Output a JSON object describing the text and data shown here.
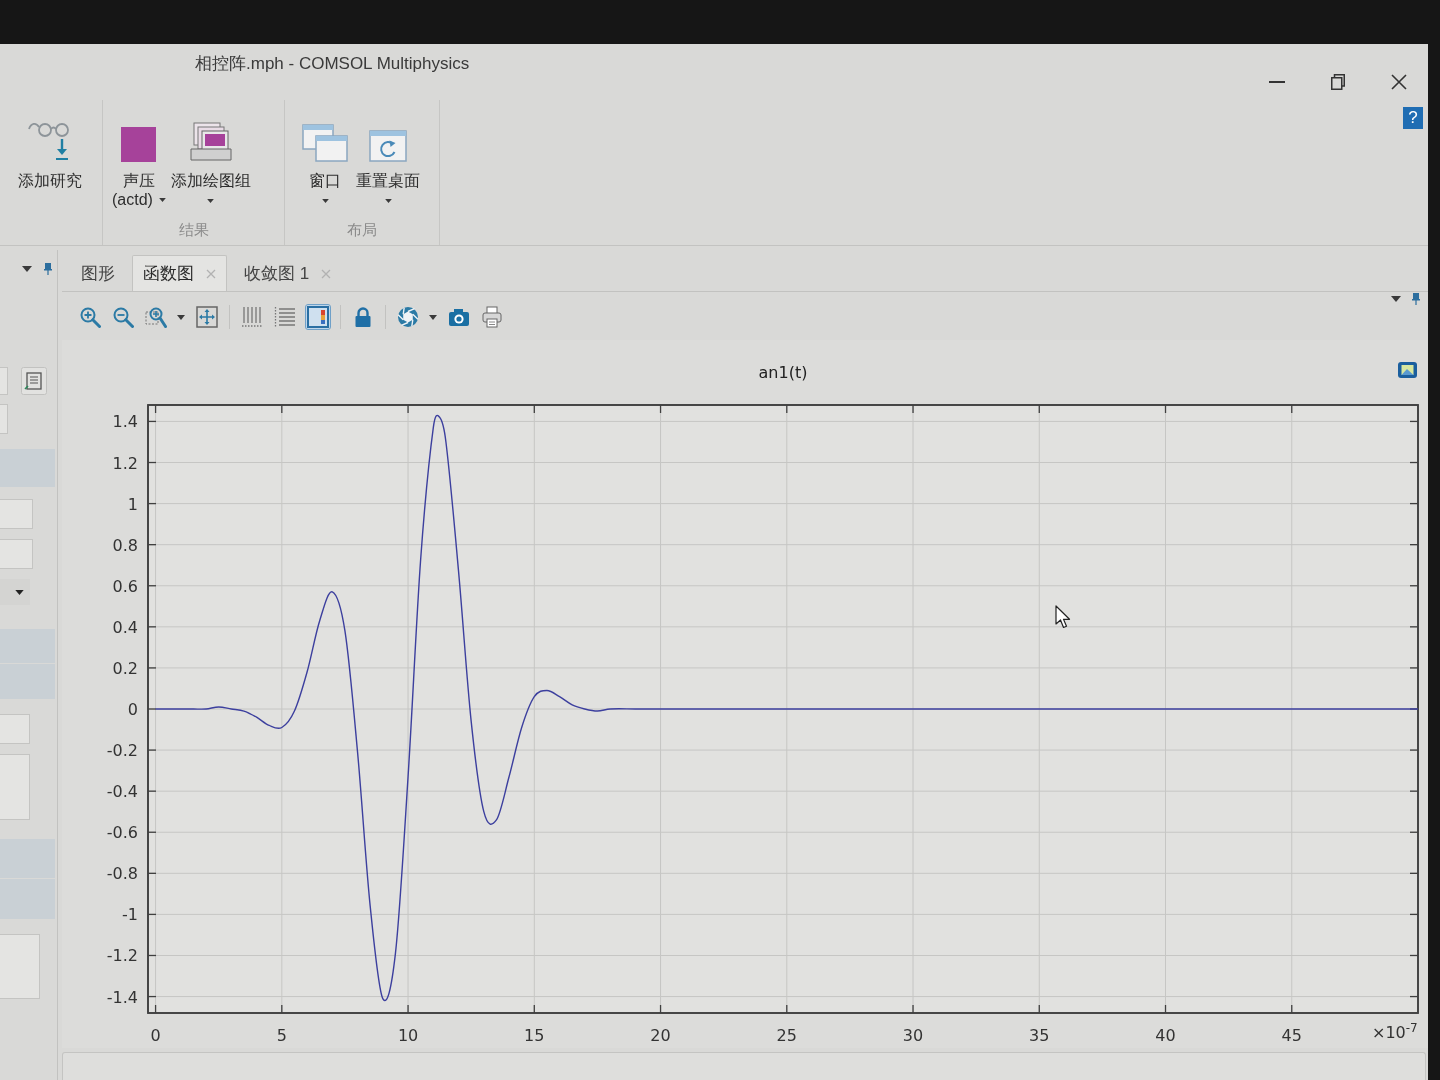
{
  "window": {
    "title": "相控阵.mph - COMSOL Multiphysics"
  },
  "ribbon": {
    "groups": [
      {
        "buttons": [
          {
            "label": "添加研究",
            "dropdown": false
          }
        ]
      },
      {
        "label": "结果",
        "buttons": [
          {
            "label": "声压",
            "sublabel": "(actd)",
            "dropdown": true
          },
          {
            "label": "添加绘图组",
            "dropdown": true
          }
        ]
      },
      {
        "label": "布局",
        "buttons": [
          {
            "label": "窗口",
            "dropdown": true
          },
          {
            "label": "重置桌面",
            "dropdown": true
          }
        ]
      }
    ],
    "help": {
      "label": "?"
    }
  },
  "graphics_window": {
    "tabs": [
      {
        "label": "图形",
        "selected": false,
        "closable": false
      },
      {
        "label": "函数图",
        "selected": true,
        "closable": true
      },
      {
        "label": "收敛图 1",
        "selected": false,
        "closable": true
      }
    ],
    "toolbar": [
      [
        {
          "dropdown": false,
          "on": false
        },
        {
          "dropdown": false,
          "on": false
        },
        {
          "dropdown": true,
          "on": false
        },
        {
          "dropdown": false,
          "on": false
        }
      ],
      [
        {
          "dropdown": false,
          "on": false
        },
        {
          "dropdown": false,
          "on": false
        },
        {
          "dropdown": false,
          "on": true
        }
      ],
      [
        {
          "dropdown": false,
          "on": false
        }
      ],
      [
        {
          "dropdown": true,
          "on": false
        },
        {
          "dropdown": false,
          "on": false
        },
        {
          "dropdown": false,
          "on": false
        }
      ]
    ],
    "plot": {
      "chart_data": [
        {
          "type": "line",
          "title": "an1(t)",
          "x": [
            0,
            0.5,
            1,
            1.5,
            2,
            2.5,
            3,
            3.5,
            4,
            4.5,
            5,
            5.5,
            6,
            6.5,
            7,
            7.5,
            8,
            8.5,
            9,
            9.5,
            10,
            10.5,
            11,
            11.25,
            11.5,
            12,
            12.5,
            13,
            13.5,
            14,
            14.5,
            15,
            15.5,
            16,
            16.5,
            17,
            17.5,
            18,
            19,
            20,
            25,
            30,
            35,
            40,
            45,
            50
          ],
          "values": [
            0,
            0,
            0,
            0,
            0,
            0.01,
            0,
            -0.01,
            -0.04,
            -0.08,
            -0.09,
            -0.01,
            0.18,
            0.43,
            0.57,
            0.38,
            -0.21,
            -0.96,
            -1.41,
            -1.19,
            -0.33,
            0.73,
            1.37,
            1.42,
            1.3,
            0.67,
            -0.06,
            -0.5,
            -0.54,
            -0.33,
            -0.09,
            0.06,
            0.09,
            0.06,
            0.02,
            0,
            -0.01,
            0,
            0,
            0,
            0,
            0,
            0,
            0,
            0,
            0
          ],
          "color": "#3c3f9e",
          "xlim": [
            -0.3,
            50
          ],
          "ylim": [
            -1.48,
            1.48
          ],
          "xticks": [
            0,
            5,
            10,
            15,
            20,
            25,
            30,
            35,
            40,
            45
          ],
          "yticks": [
            -1.4,
            -1.2,
            -1,
            -0.8,
            -0.6,
            -0.4,
            -0.2,
            0,
            0.2,
            0.4,
            0.6,
            0.8,
            1,
            1.2,
            1.4
          ],
          "grid": true,
          "annotations": [
            "×10$^{-7}$"
          ]
        }
      ]
    }
  }
}
